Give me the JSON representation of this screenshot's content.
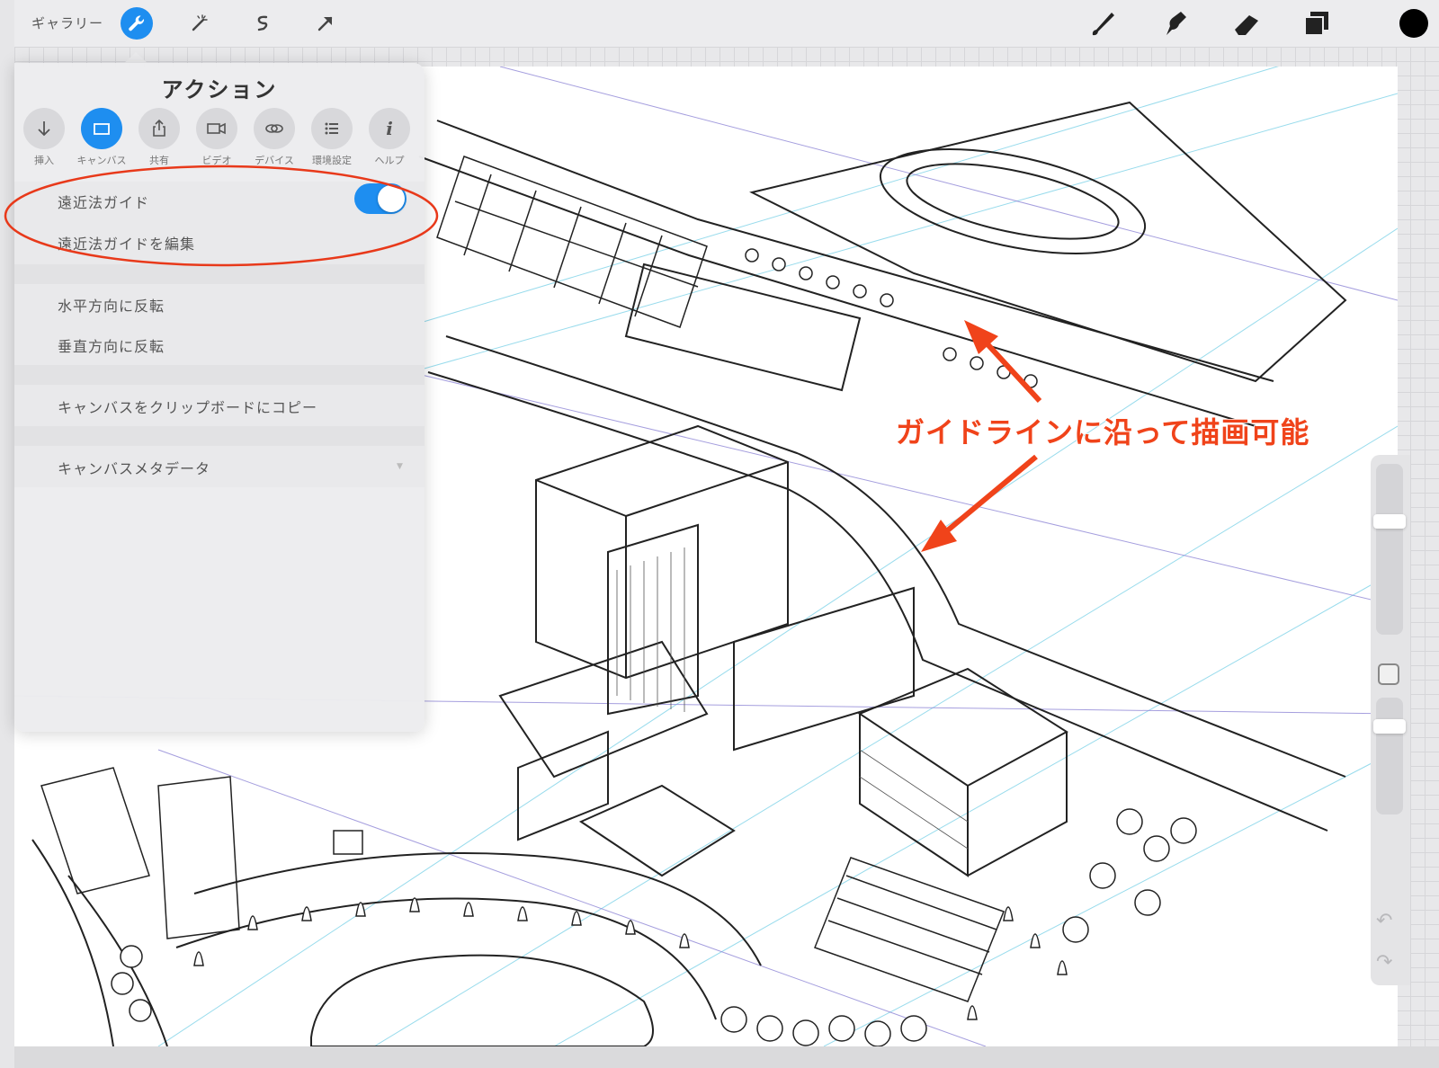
{
  "toolbar": {
    "gallery_label": "ギャラリー",
    "left_tools": [
      "wrench-icon",
      "magic-wand-icon",
      "selection-icon",
      "transform-arrow-icon"
    ],
    "right_tools": [
      "brush-icon",
      "smudge-icon",
      "eraser-icon",
      "layers-icon"
    ],
    "current_color": "#000000",
    "accent_color": "#1e8ef0"
  },
  "actions_panel": {
    "title": "アクション",
    "tabs": [
      {
        "label": "挿入",
        "icon": "arrow-down-icon"
      },
      {
        "label": "キャンバス",
        "icon": "canvas-rect-icon"
      },
      {
        "label": "共有",
        "icon": "share-icon"
      },
      {
        "label": "ビデオ",
        "icon": "video-camera-icon"
      },
      {
        "label": "デバイス",
        "icon": "link-icon"
      },
      {
        "label": "環境設定",
        "icon": "list-icon"
      },
      {
        "label": "ヘルプ",
        "icon": "info-icon"
      }
    ],
    "active_tab": "キャンバス",
    "items": {
      "perspective_guide": "遠近法ガイド",
      "perspective_guide_on": true,
      "edit_perspective_guide": "遠近法ガイドを編集",
      "flip_horizontal": "水平方向に反転",
      "flip_vertical": "垂直方向に反転",
      "copy_to_clipboard": "キャンバスをクリップボードにコピー",
      "canvas_metadata": "キャンバスメタデータ"
    }
  },
  "annotation": {
    "text": "ガイドラインに沿って描画可能",
    "color": "#f0431a"
  }
}
